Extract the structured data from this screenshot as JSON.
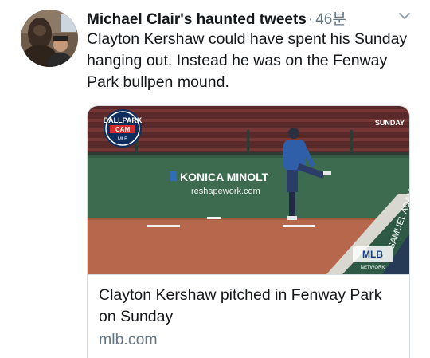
{
  "tweet": {
    "author_name": "Michael Clair's haunted tweets",
    "separator": "·",
    "timestamp": "46분",
    "text": "Clayton Kershaw could have spent his Sunday hanging out. Instead he was on the Fenway Park bullpen mound.",
    "avatar_icon": "profile-photo",
    "menu_icon": "chevron-down-icon"
  },
  "card": {
    "title": "Clayton Kershaw pitched in Fenway Park on Sunday",
    "domain": "mlb.com",
    "image": {
      "ballpark_cam_top": "BALLPARK",
      "ballpark_cam_mid": "CAM",
      "ballpark_cam_bottom": "MLB",
      "day_label": "SUNDAY",
      "sign_brand": "KONICA MINOLT",
      "sign_url": "reshapework.com",
      "network_logo": "MLB",
      "network_sub": "NETWORK",
      "wall_text": "SAMUEL ADAMS"
    }
  },
  "colors": {
    "text": "#14171a",
    "secondary": "#657786",
    "border": "#d6dde2",
    "wall_green": "#3d6b4f",
    "dirt": "#b7684c"
  }
}
